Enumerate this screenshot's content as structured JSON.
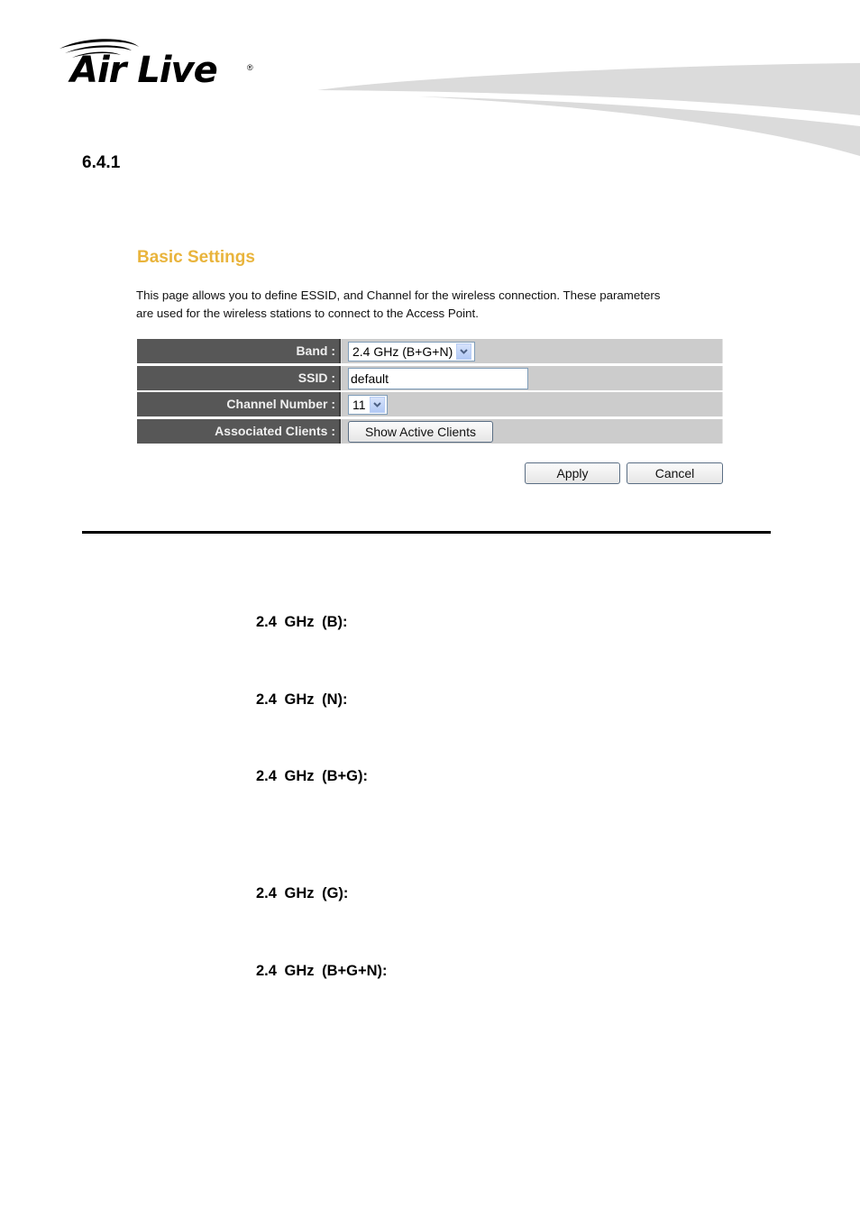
{
  "header": {
    "brand_name": "Air Live",
    "registered_mark": "®",
    "icon": "wifi-arc-logo-icon"
  },
  "section": {
    "number": "6.4.1"
  },
  "panel": {
    "title": "Basic Settings",
    "description": "This page allows you to define ESSID, and Channel for the wireless connection. These parameters are used for the wireless stations to connect to the Access Point.",
    "title_color": "#e9b43c",
    "rows": [
      {
        "label": "Band :",
        "type": "select",
        "value": "2.4 GHz (B+G+N)"
      },
      {
        "label": "SSID :",
        "type": "text",
        "value": "default"
      },
      {
        "label": "Channel Number :",
        "type": "select",
        "value": "11"
      },
      {
        "label": "Associated Clients :",
        "type": "button",
        "value": "Show Active Clients"
      }
    ],
    "apply_label": "Apply",
    "cancel_label": "Cancel"
  },
  "band_terms": [
    "2.4 GHz (B):",
    "2.4 GHz (N):",
    "2.4 GHz (B+G):",
    "2.4 GHz (G):",
    "2.4 GHz (B+G+N):"
  ]
}
